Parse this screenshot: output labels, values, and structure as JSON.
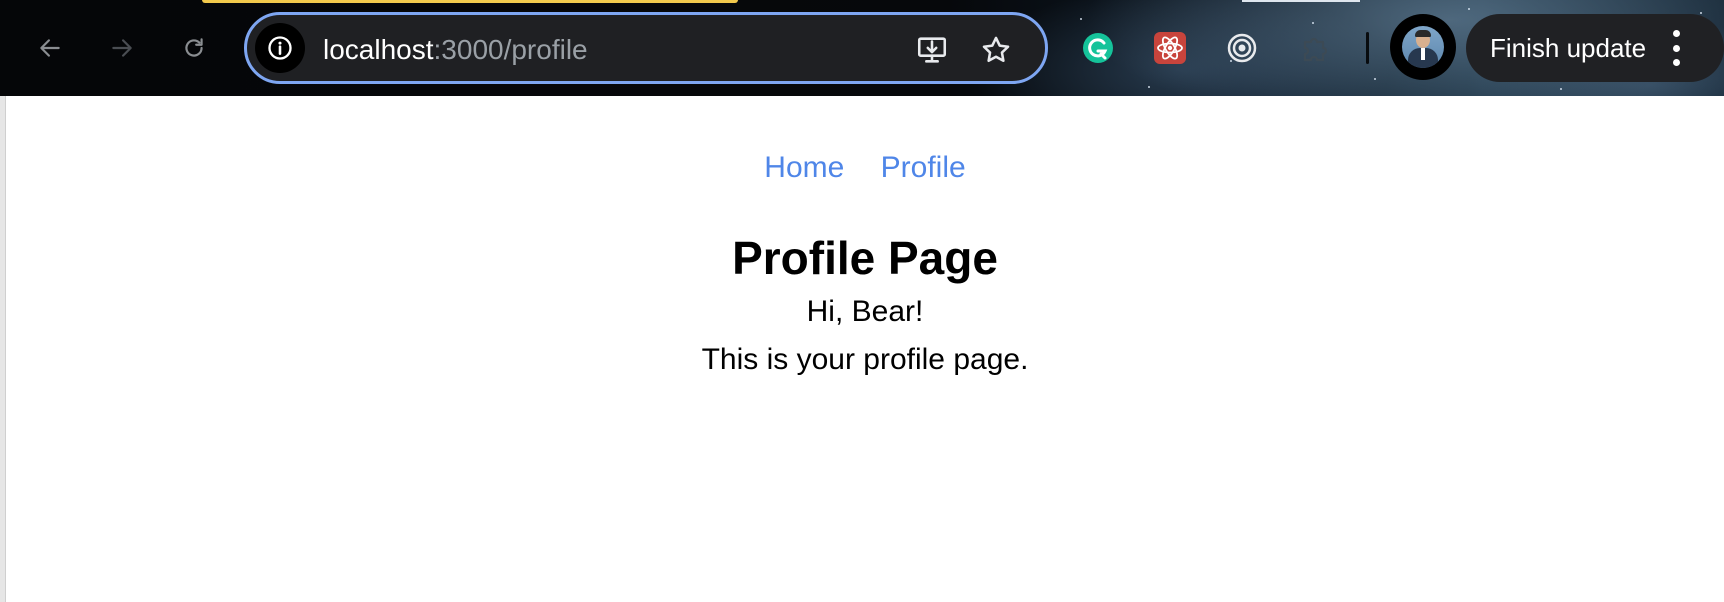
{
  "browser": {
    "url_host": "localhost",
    "url_path": ":3000/profile",
    "finish_update_label": "Finish update",
    "icons": {
      "back": "arrow-left-icon",
      "forward": "arrow-right-icon",
      "reload": "reload-icon",
      "site_info": "info-icon",
      "install": "install-app-icon",
      "bookmark": "star-icon",
      "extensions": [
        "grammarly-icon",
        "react-devtools-icon",
        "target-extension-icon",
        "puzzle-extension-icon"
      ],
      "menu": "more-vertical-icon"
    },
    "colors": {
      "omnibox_focus_ring": "#7ea6f2",
      "top_accent": "#f2c94c"
    }
  },
  "page": {
    "nav": {
      "home_label": "Home",
      "profile_label": "Profile"
    },
    "title": "Profile Page",
    "greeting": "Hi, Bear!",
    "description": "This is your profile page.",
    "colors": {
      "link": "#4f86e8",
      "text": "#000000"
    }
  }
}
